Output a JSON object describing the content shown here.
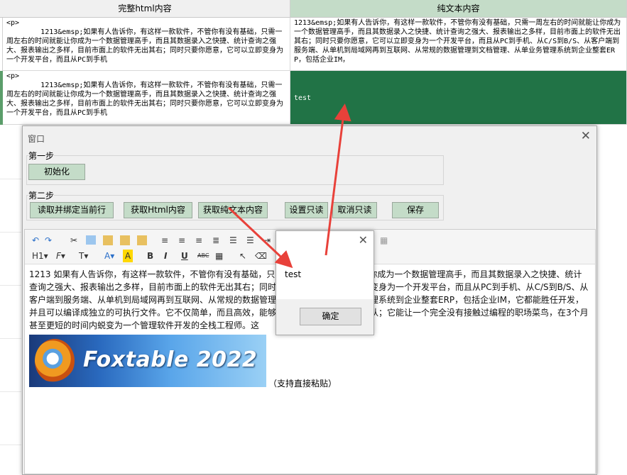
{
  "grid": {
    "col1_header": "完整html内容",
    "col2_header": "纯文本内容",
    "row1_html": "<p>\n        1213&emsp;如果有人告诉你，有这样一款软件，不管你有没有基础，只需一周左右的时间就能让你成为一个数据管理高手，而且其数据录入之快捷、统计查询之强大、报表输出之多样，目前市面上的软件无出其右；同时只要你愿意，它可以立即变身为一个开发平台，而且从PC到手机",
    "row1_text": "1213&emsp;如果有人告诉你，有这样一款软件，不管你有没有基础，只需一周左右的时间就能让你成为一个数据管理高手，而且其数据录入之快捷、统计查询之强大、报表输出之多样，目前市面上的软件无出其右；同时只要你愿意，它可以立即变身为一个开发平台，而且从PC到手机、从C/S到B/S、从客户端到服务端、从单机到局域网再到互联网、从常规的数据管理到文档管理、从单业务管理系统到企业整套ERP，包括企业IM，",
    "row2_html": "<p>\n        1213&emsp;如果有人告诉你，有这样一款软件，不管你有没有基础，只需一周左右的时间就能让你成为一个数据管理高手，而且其数据录入之快捷、统计查询之强大、报表输出之多样，目前市面上的软件无出其右；同时只要你愿意，它可以立即变身为一个开发平台，而且从PC到手机",
    "row2_text": "test"
  },
  "window": {
    "title": "窗口",
    "close": "✕",
    "step1_label": "第一步",
    "step2_label": "第二步",
    "init_button": "初始化",
    "read_bind_button": "读取并绑定当前行",
    "get_html_button": "获取Html内容",
    "get_text_button": "获取纯文本内容",
    "set_readonly_button": "设置只读",
    "cancel_readonly_button": "取消只读",
    "save_button": "保存"
  },
  "editor": {
    "toolbar": {
      "heading": "H1",
      "font": "F",
      "font_size": "T",
      "bold": "B",
      "italic": "I",
      "underline": "U",
      "strike": "ABC"
    },
    "content_line1": "1213   如果有人告诉你，有这样一款软件，不管你有没有基础，只需一周左右的时间就能让你成为一个数据管理高手，而且其数据录入之快捷、统计查询之强大、报表输出之多样，目前市面上的软件无出其右；同时只要你愿意，它可以立即变身为一个开发平台，而且从PC到手机、从C/S到B/S、从客户端到服务端、从单机到局域网再到互联网、从常规的数据管理到文档管理、从单业务管理系统到企业整套ERP，包括企业IM，它都能胜任开发，并且可以编译成独立的可执行文件。它不仅简单，而且高效，能够让你组建自己的开发小团队；它能让一个完全没有接触过编程的职场菜鸟，在3个月甚至更短的时间内蜕变为一个管理软件开发的全栈工程师。",
    "content_tail": "这",
    "logo_text": "Foxtable 2022",
    "paste_note": "（支持直接粘贴）"
  },
  "messagebox": {
    "close": "✕",
    "text": "test",
    "ok_button": "确定"
  },
  "colors": {
    "header_green": "#c4dcc8",
    "selected_cell": "#217346",
    "arrow_red": "#e8413a"
  }
}
